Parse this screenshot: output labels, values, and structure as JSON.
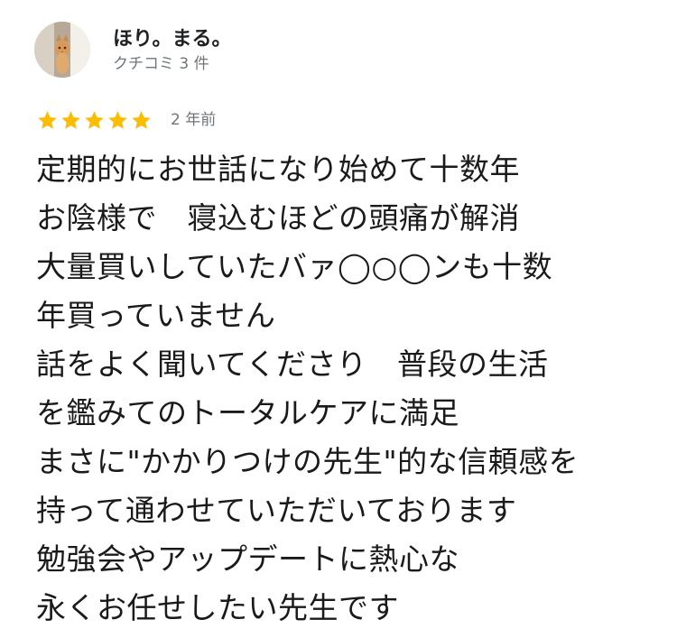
{
  "review": {
    "author": {
      "name": "ほり。まる。",
      "meta": "クチコミ 3 件"
    },
    "rating": 5,
    "time": "2 年前",
    "star_color": "#fbbc04",
    "body_lines": [
      "定期的にお世話になり始めて十数年",
      "お陰様で　寝込むほどの頭痛が解消",
      "大量買いしていたバァ◯○◯ンも十数",
      "年買っていません",
      "話をよく聞いてくださり　普段の生活",
      "を鑑みてのトータルケアに満足",
      "まさに\"かかりつけの先生\"的な信頼感を",
      "持って通わせていただいております",
      "勉強会やアップデートに熱心な",
      "永くお任せしたい先生です"
    ]
  }
}
